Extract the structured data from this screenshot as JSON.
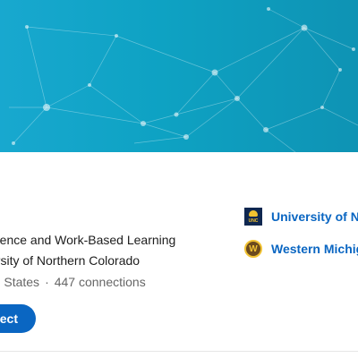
{
  "profile": {
    "headline": "Experience and Work-Based Learning",
    "subline": "University of Northern Colorado",
    "location": "United States",
    "separator": "·",
    "connections": "447 connections",
    "connect_label": "Connect"
  },
  "education": [
    {
      "name": "University of Northern Colorado",
      "logo_text": "UNC",
      "logo_icon": "unc-logo-icon"
    },
    {
      "name": "Western Michigan University",
      "logo_text": "W",
      "logo_icon": "wmu-logo-icon"
    }
  ],
  "colors": {
    "banner_start": "#18a8cf",
    "banner_end": "#0e93b4",
    "link": "#0a66c2",
    "button": "#0a66c2"
  }
}
